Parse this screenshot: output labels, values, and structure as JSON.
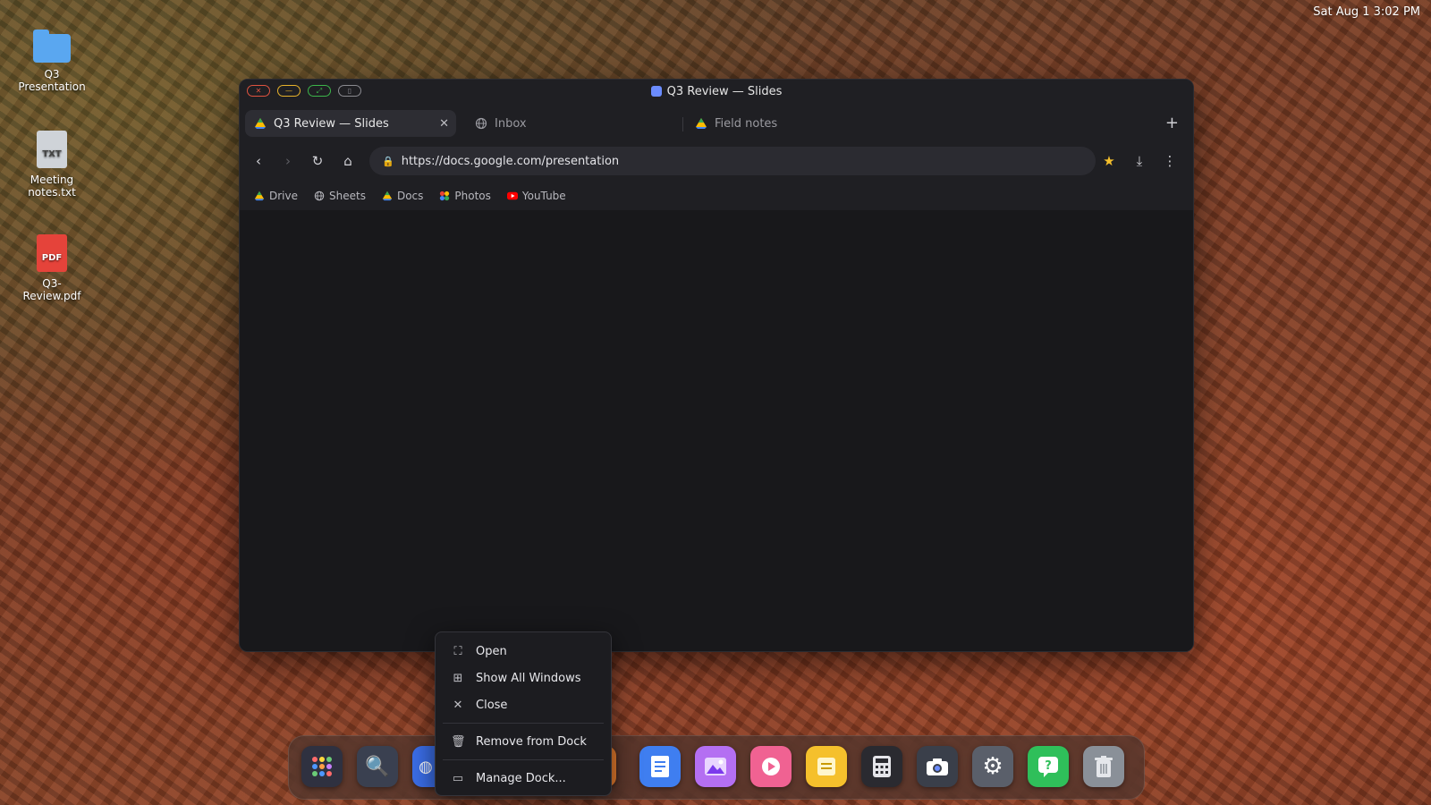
{
  "system": {
    "clock": "Sat Aug 1 3:02 PM"
  },
  "desktop": {
    "icons": [
      {
        "label": "Q3\nPresentation",
        "type": "folder"
      },
      {
        "label": "Meeting\nnotes.txt",
        "type": "txt",
        "badge": "TXT"
      },
      {
        "label": "Q3-\nReview.pdf",
        "type": "pdf",
        "badge": "PDF"
      }
    ]
  },
  "browser": {
    "window_title": "Q3 Review — Slides",
    "tabs": [
      {
        "label": "Q3 Review — Slides",
        "active": true
      },
      {
        "label": "Inbox",
        "active": false
      },
      {
        "label": "Field notes",
        "active": false
      }
    ],
    "url": "https://docs.google.com/presentation",
    "bookmarks": [
      {
        "label": "Drive",
        "icon": "drive-icon"
      },
      {
        "label": "Sheets",
        "icon": "globe-icon"
      },
      {
        "label": "Docs",
        "icon": "drive-icon"
      },
      {
        "label": "Photos",
        "icon": "photos-icon"
      },
      {
        "label": "YouTube",
        "icon": "youtube-icon"
      }
    ]
  },
  "context_menu": {
    "items": [
      {
        "label": "Open",
        "icon": "expand-icon"
      },
      {
        "label": "Show All Windows",
        "icon": "grid-icon"
      },
      {
        "label": "Close",
        "icon": "close-icon"
      },
      {
        "label": "Remove from Dock",
        "icon": "trash-icon"
      },
      {
        "label": "Manage Dock...",
        "icon": "dock-icon"
      }
    ]
  },
  "dock": {
    "apps": [
      {
        "name": "launcher",
        "color": "#2f3140"
      },
      {
        "name": "search",
        "color": "#3a4050"
      },
      {
        "name": "browser",
        "color": "#3b6ee8"
      },
      {
        "name": "files",
        "color": "#e87d2e"
      },
      {
        "name": "docs",
        "color": "#3f7ef0"
      },
      {
        "name": "photos",
        "color": "#b46ff2"
      },
      {
        "name": "media",
        "color": "#f06292"
      },
      {
        "name": "notes",
        "color": "#f5c02c"
      },
      {
        "name": "calculator",
        "color": "#2a2a30"
      },
      {
        "name": "camera",
        "color": "#3a3f4a"
      },
      {
        "name": "settings",
        "color": "#5a5f6a"
      },
      {
        "name": "help",
        "color": "#2fbf5a"
      },
      {
        "name": "trash",
        "color": "#8a9098"
      }
    ]
  }
}
